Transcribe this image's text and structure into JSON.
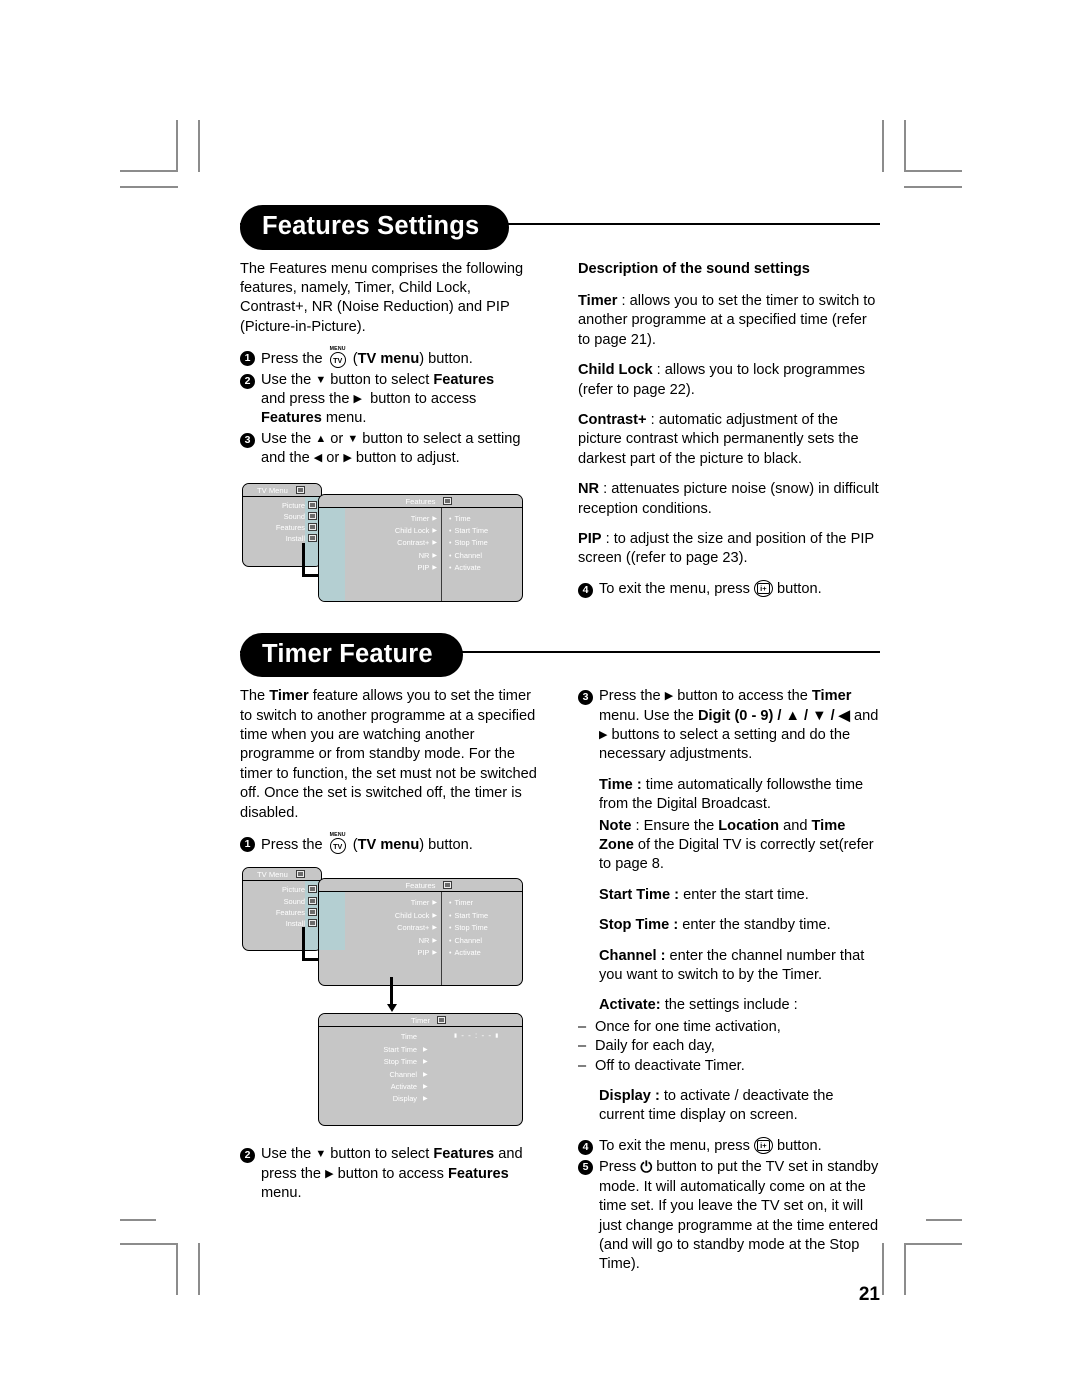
{
  "page_number": "21",
  "sections": [
    {
      "heading": "Features Settings",
      "left": {
        "intro": "The Features menu comprises the following features, namely,  Timer, Child Lock, Contrast+, NR (Noise Reduction) and PIP (Picture-in-Picture).",
        "steps": [
          {
            "num": "1",
            "parts": [
              {
                "t": "Press the ",
                "b": false
              },
              {
                "t": "TVMENU_ICON",
                "icon": "tv-menu-button-icon"
              },
              {
                "t": " (",
                "b": false
              },
              {
                "t": "TV menu",
                "b": true
              },
              {
                "t": ") button.",
                "b": false
              }
            ]
          },
          {
            "num": "2",
            "parts": [
              {
                "t": "Use the ",
                "b": false
              },
              {
                "t": "▼",
                "arrow": true
              },
              {
                "t": " button to select ",
                "b": false
              },
              {
                "t": "Features",
                "b": true
              },
              {
                "t": " and press the ",
                "b": false
              },
              {
                "t": "▶",
                "arrow": true
              },
              {
                "t": "  button to access ",
                "b": false
              },
              {
                "t": "Features",
                "b": true
              },
              {
                "t": " menu.",
                "b": false
              }
            ]
          },
          {
            "num": "3",
            "parts": [
              {
                "t": "Use the ",
                "b": false
              },
              {
                "t": "▲",
                "arrow": true
              },
              {
                "t": " or ",
                "b": false
              },
              {
                "t": "▼",
                "arrow": true
              },
              {
                "t": " button to select a setting and the ",
                "b": false
              },
              {
                "t": "◀",
                "arrow": true
              },
              {
                "t": " or ",
                "b": false
              },
              {
                "t": "▶",
                "arrow": true
              },
              {
                "t": " button to adjust.",
                "b": false
              }
            ]
          }
        ]
      },
      "right": {
        "title": "Description of the sound settings",
        "items": [
          {
            "term": "Timer",
            "sep": " :  ",
            "text": "allows you to set the timer to switch to another programme at a specified time (refer to page 21)."
          },
          {
            "term": "Child Lock",
            "sep": " : ",
            "text": "allows you to lock programmes (refer to page 22)."
          },
          {
            "term": "Contrast+",
            "sep": " : ",
            "text": "automatic adjustment of the picture contrast which permanently sets the darkest part of the picture to black."
          },
          {
            "term": "NR",
            "sep": " : ",
            "text": "attenuates picture noise (snow) in difficult reception conditions."
          },
          {
            "term": "PIP",
            "sep": " : ",
            "text": "to adjust the size and position of the PIP screen ((refer to page 23)."
          }
        ],
        "exit_step": {
          "num": "4",
          "before": "To exit the menu, press ",
          "after": " button."
        }
      }
    },
    {
      "heading": "Timer Feature",
      "left": {
        "intro_pre": "The ",
        "intro_bold": "Timer",
        "intro_post": " feature allows you to set the timer to switch to another programme at a specified time when you are watching another programme or from standby mode. For the timer to function, the set must not be switched off. Once the set is switched off, the timer is disabled.",
        "step1": {
          "num": "1",
          "before": "Press the ",
          "bold": "TV menu",
          "after": ") button.",
          "open": " ("
        },
        "step2": {
          "num": "2",
          "a": "Use the ",
          "arrow1": "▼",
          "b": " button to select ",
          "bold1": "Features",
          "c": " and press the ",
          "arrow2": "▶",
          "d": " button to access ",
          "bold2": "Features",
          "e": " menu."
        }
      },
      "right": {
        "step3": {
          "num": "3",
          "a": "Press the ",
          "arrow1": "▶",
          "b": " button to access the ",
          "bold1": "Timer",
          "c": " menu. Use the ",
          "bold2": "Digit (0 - 9) / ▲ / ▼ / ◀",
          "d": " and ",
          "arrow2": "▶",
          "e": " buttons to select a setting and do the necessary adjustments."
        },
        "time_term": "Time :",
        "time_text": " time automatically followsthe time from the Digital Broadcast.",
        "note_term": "Note",
        "note_a": " : Ensure the ",
        "note_bold1": "Location",
        "note_b": " and ",
        "note_bold2": "Time Zone",
        "note_c": " of the Digital TV is correctly set(refer to page 8.",
        "items": [
          {
            "term": "Start Time :",
            "text": " enter the start time."
          },
          {
            "term": "Stop Time :",
            "text": " enter the standby time."
          },
          {
            "term": "Channel :",
            "text": " enter the channel number that you want to switch to by the Timer."
          }
        ],
        "activate_term": "Activate:",
        "activate_text": " the settings include :",
        "activate_list": [
          "Once for one time activation,",
          "Daily for each day,",
          "Off to deactivate Timer."
        ],
        "display_term": "Display :",
        "display_text": " to activate / deactivate the current time display on screen.",
        "step4": {
          "num": "4",
          "before": "To exit the menu, press ",
          "after": " button."
        },
        "step5": {
          "num": "5",
          "before": "Press ",
          "after": " button to put the TV set in standby mode. It will automatically come on at the time set. If you leave the TV set on, it will just change programme at the time entered (and will go to standby mode at the Stop Time)."
        }
      }
    }
  ],
  "osd": {
    "tv_menu_title": "TV Menu",
    "tv_menu_items": [
      "Picture",
      "Sound",
      "Features",
      "Install"
    ],
    "features_title": "Features",
    "features_items": [
      "Timer",
      "Child Lock",
      "Contrast+",
      "NR",
      "PIP"
    ],
    "features_sub_1": [
      "Time",
      "Start Time",
      "Stop Time",
      "Channel",
      "Activate"
    ],
    "features_sub_2": [
      "Timer",
      "Start Time",
      "Stop Time",
      "Channel",
      "Activate"
    ],
    "timer_title": "Timer",
    "timer_items": [
      "Time",
      "Start Time",
      "Stop Time",
      "Channel",
      "Activate",
      "Display"
    ],
    "timer_clock": "- - : - -"
  },
  "colors": {
    "osd_background": "#c6c6c6",
    "osd_highlight": "#b4cfd2",
    "heading_pill": "#000000",
    "crop_mark": "#8c8c8c"
  }
}
